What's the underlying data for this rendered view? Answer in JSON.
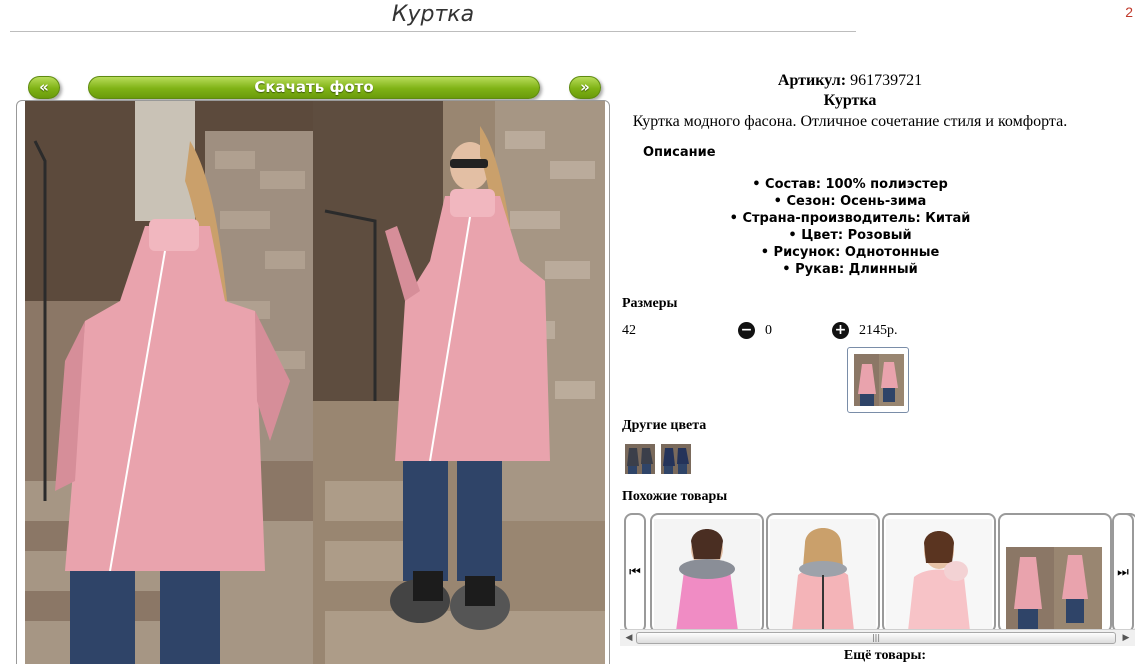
{
  "page": {
    "title": "Куртка",
    "corner_mark": "2"
  },
  "gallery": {
    "prev_label": "«",
    "download_label": "Скачать фото",
    "next_label": "»"
  },
  "product": {
    "sku_label": "Артикул:",
    "sku_value": "961739721",
    "name": "Куртка",
    "tagline": "Куртка модного фасона. Отличное сочетание стиля и комфорта."
  },
  "description": {
    "title": "Описание",
    "attributes": [
      "Состав: 100% полиэстер",
      "Сезон: Осень-зима",
      "Страна-производитель: Китай",
      "Цвет: Розовый",
      "Рисунок: Однотонные",
      "Рукав: Длинный"
    ]
  },
  "sizes": {
    "title": "Размеры",
    "rows": [
      {
        "size": "42",
        "minus": "−",
        "qty": "0",
        "plus": "+",
        "price": "2145р."
      }
    ]
  },
  "other_colors": {
    "title": "Другие цвета"
  },
  "similar": {
    "title": "Похожие товары",
    "prev_icon": "⏮",
    "next_icon": "⏭",
    "scroll_grip": "|||",
    "scroll_left": "◀",
    "scroll_right": "▶"
  },
  "more": {
    "title": "Ещё товары:"
  },
  "colors": {
    "jacket_pink": "#e9a3ad",
    "accent_green": "#7fb215",
    "jeans": "#2f4468"
  }
}
